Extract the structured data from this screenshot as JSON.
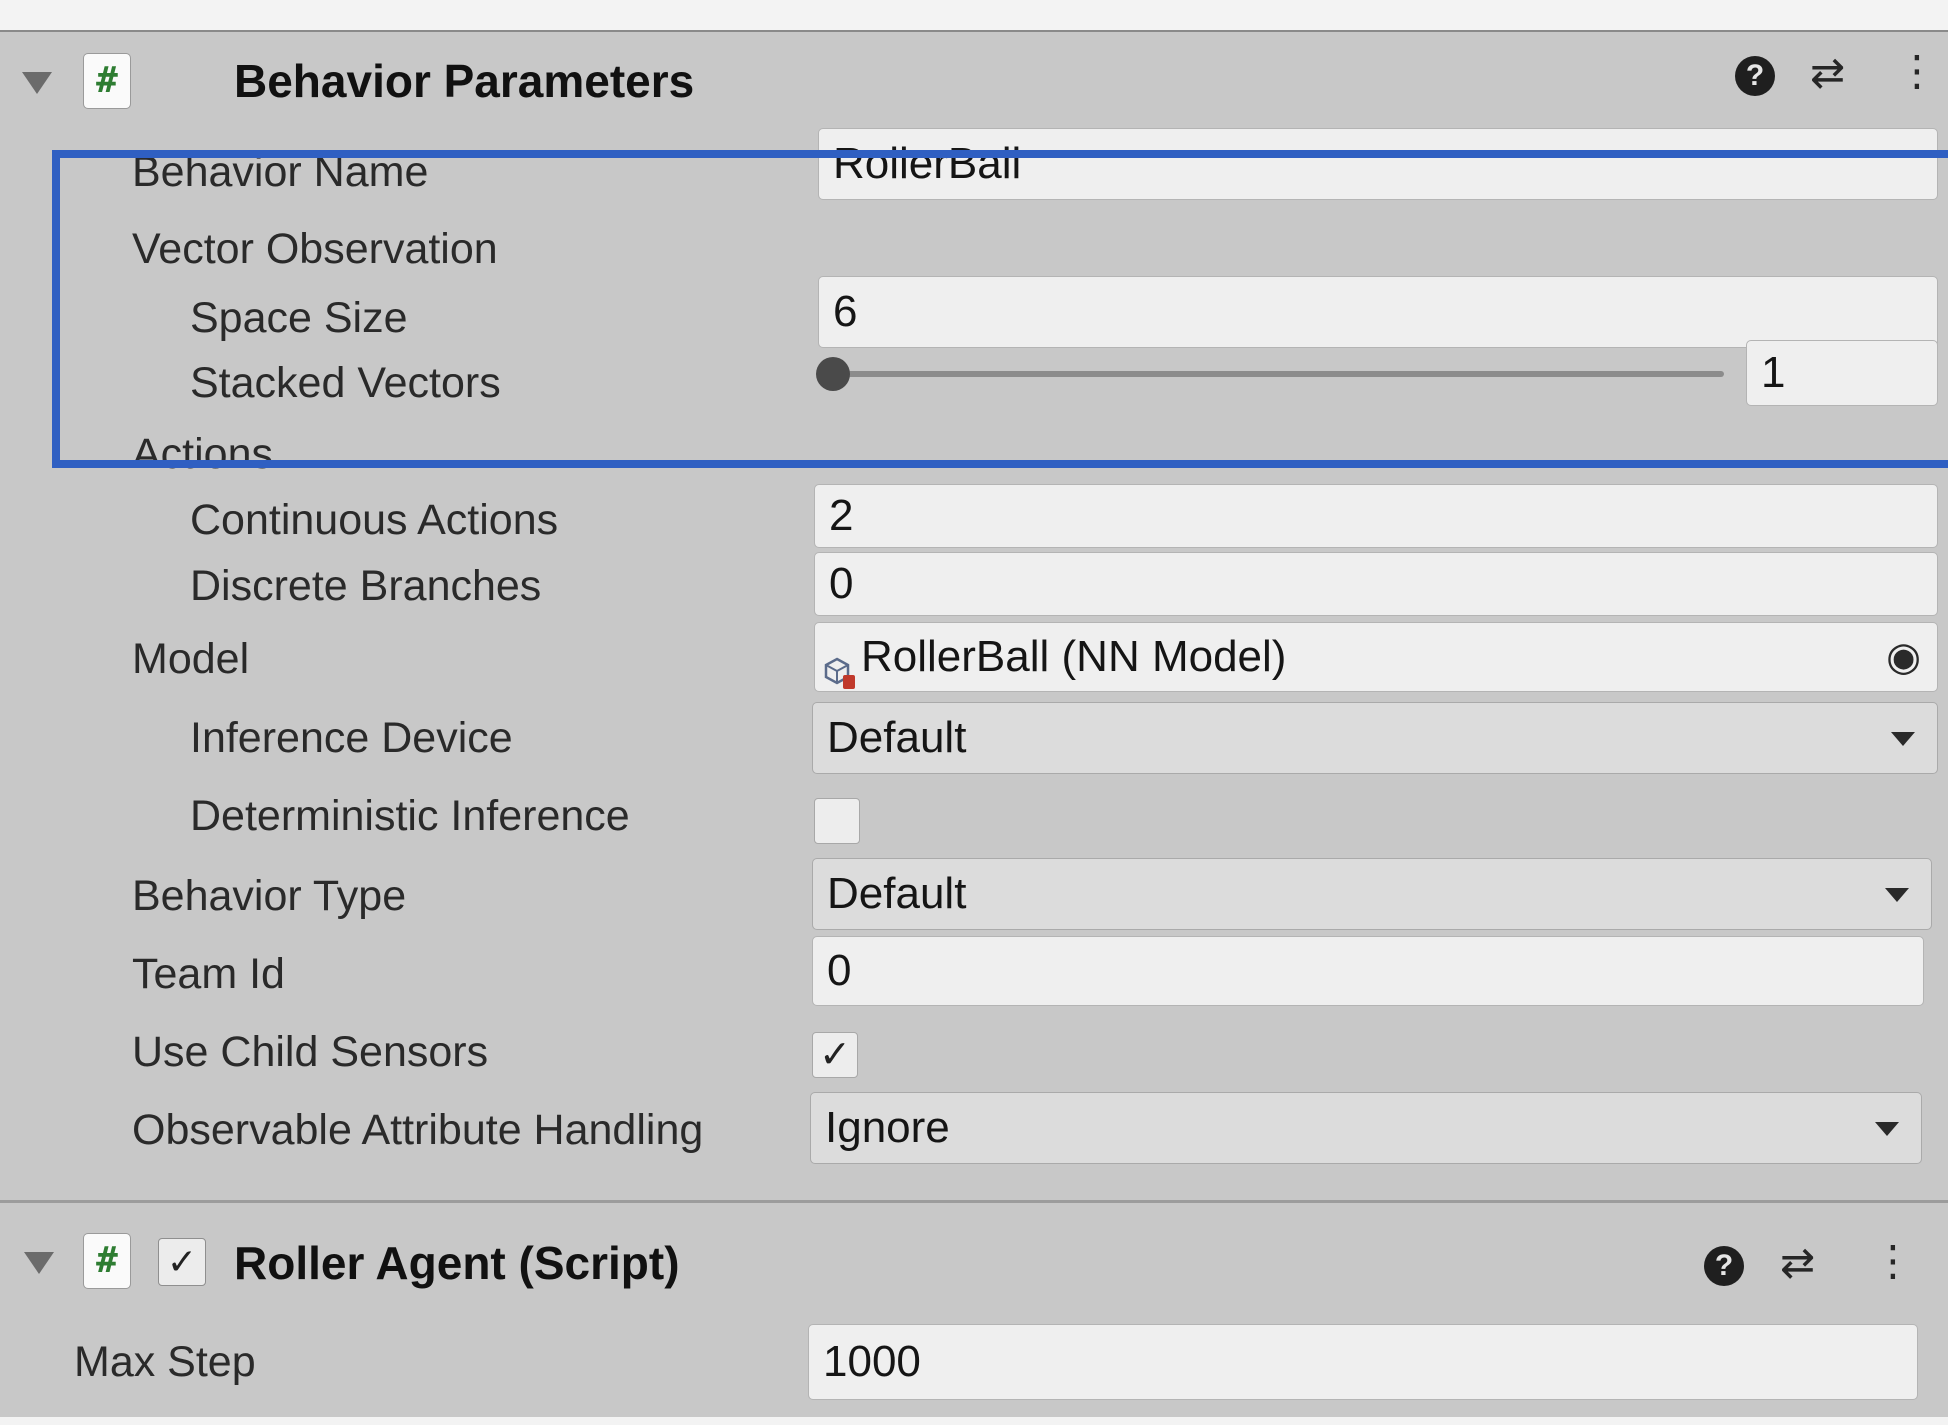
{
  "behavior_parameters": {
    "title": "Behavior Parameters",
    "fields": {
      "behavior_name": {
        "label": "Behavior Name",
        "value": "RollerBall"
      },
      "vector_observation": {
        "label": "Vector Observation"
      },
      "space_size": {
        "label": "Space Size",
        "value": "6"
      },
      "stacked_vectors": {
        "label": "Stacked Vectors",
        "value": "1",
        "slider_fraction": 0.0
      },
      "actions": {
        "label": "Actions"
      },
      "continuous_actions": {
        "label": "Continuous Actions",
        "value": "2"
      },
      "discrete_branches": {
        "label": "Discrete Branches",
        "value": "0"
      },
      "model": {
        "label": "Model",
        "value": "RollerBall (NN Model)"
      },
      "inference_device": {
        "label": "Inference Device",
        "value": "Default"
      },
      "deterministic_inference": {
        "label": "Deterministic Inference",
        "checked": false
      },
      "behavior_type": {
        "label": "Behavior Type",
        "value": "Default"
      },
      "team_id": {
        "label": "Team Id",
        "value": "0"
      },
      "use_child_sensors": {
        "label": "Use Child Sensors",
        "checked": true,
        "check_glyph": "✓"
      },
      "observable_attribute_handling": {
        "label": "Observable Attribute Handling",
        "value": "Ignore"
      }
    }
  },
  "roller_agent": {
    "title": "Roller Agent (Script)",
    "enabled_glyph": "✓",
    "fields": {
      "max_step": {
        "label": "Max Step",
        "value": "1000"
      }
    }
  },
  "icons": {
    "script": "#",
    "help": "?",
    "presets": "⇄",
    "menu": "⋮",
    "object_picker": "◉",
    "model_asset": "model-asset-icon"
  },
  "colors": {
    "highlight": "#2f5fc2",
    "script_icon": "#2e7d32"
  }
}
